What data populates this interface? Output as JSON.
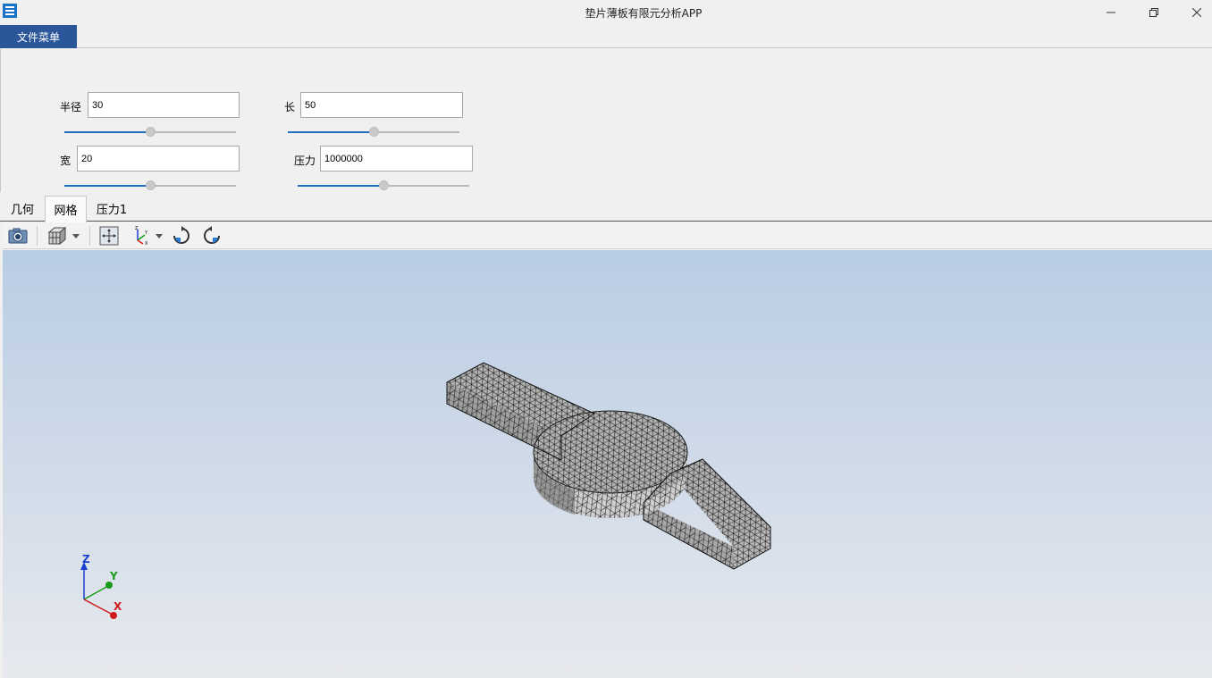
{
  "window": {
    "title": "垫片薄板有限元分析APP"
  },
  "menu": {
    "file_label": "文件菜单"
  },
  "params": {
    "radius": {
      "label": "半径",
      "value": "30",
      "fraction": 0.5
    },
    "length": {
      "label": "长",
      "value": "50",
      "fraction": 0.5
    },
    "width": {
      "label": "宽",
      "value": "20",
      "fraction": 0.5
    },
    "pressure": {
      "label": "压力",
      "value": "1000000",
      "fraction": 0.5
    }
  },
  "tabs": [
    {
      "label": "几何",
      "active": false
    },
    {
      "label": "网格",
      "active": true
    },
    {
      "label": "压力1",
      "active": false
    }
  ],
  "toolbar": {
    "icons": [
      "camera-icon",
      "box-view-icon",
      "dropdown-icon",
      "zoom-extents-icon",
      "axis-orientation-icon",
      "dropdown-icon",
      "rotate-left-icon",
      "rotate-right-icon"
    ]
  },
  "axes": {
    "x": "X",
    "y": "Y",
    "z": "Z"
  },
  "colors": {
    "accent": "#2b579a",
    "slider_fill": "#1f6ebf",
    "mesh_fill": "#b4b4b4",
    "mesh_edge": "#1e1e1e"
  }
}
